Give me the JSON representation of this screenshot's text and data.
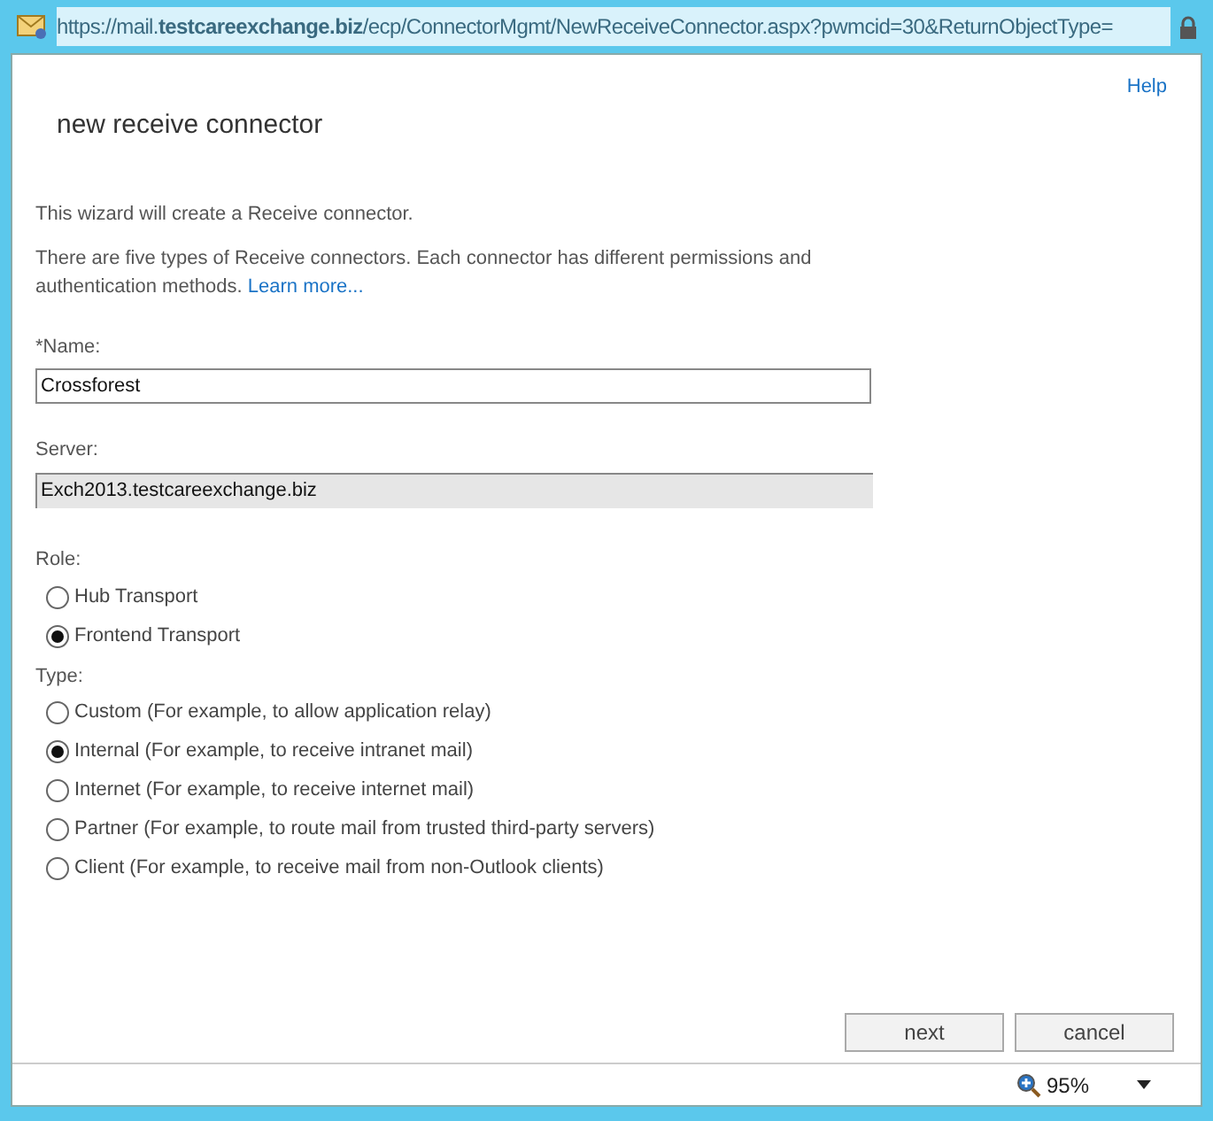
{
  "address_bar": {
    "url": "https://mail.**testcareexchange.biz**/ecp/ConnectorMgmt/NewReceiveConnector.aspx?pwmcid=30&ReturnObjectType="
  },
  "help_link": "Help",
  "title": "new receive connector",
  "intro": "This wizard will create a Receive connector.",
  "description": "There are five types of Receive connectors. Each connector has different permissions and authentication methods.",
  "learn_more_link": "Learn more...",
  "name_field": {
    "label": "*Name:",
    "value": "Crossforest"
  },
  "server_field": {
    "label": "Server:",
    "value": "Exch2013.testcareexchange.biz",
    "disabled": true
  },
  "role": {
    "label": "Role:",
    "options": [
      {
        "label": "Hub Transport",
        "selected": false
      },
      {
        "label": "Frontend Transport",
        "selected": true
      }
    ]
  },
  "type": {
    "label": "Type:",
    "options": [
      {
        "label": "Custom (For example, to allow application relay)",
        "selected": false
      },
      {
        "label": "Internal (For example, to receive intranet mail)",
        "selected": true
      },
      {
        "label": "Internet (For example, to receive internet mail)",
        "selected": false
      },
      {
        "label": "Partner (For example, to route mail from trusted third-party servers)",
        "selected": false
      },
      {
        "label": "Client (For example, to receive mail from non-Outlook clients)",
        "selected": false
      }
    ]
  },
  "buttons": [
    "next",
    "cancel"
  ],
  "status_bar": {
    "zoom": "95%"
  }
}
